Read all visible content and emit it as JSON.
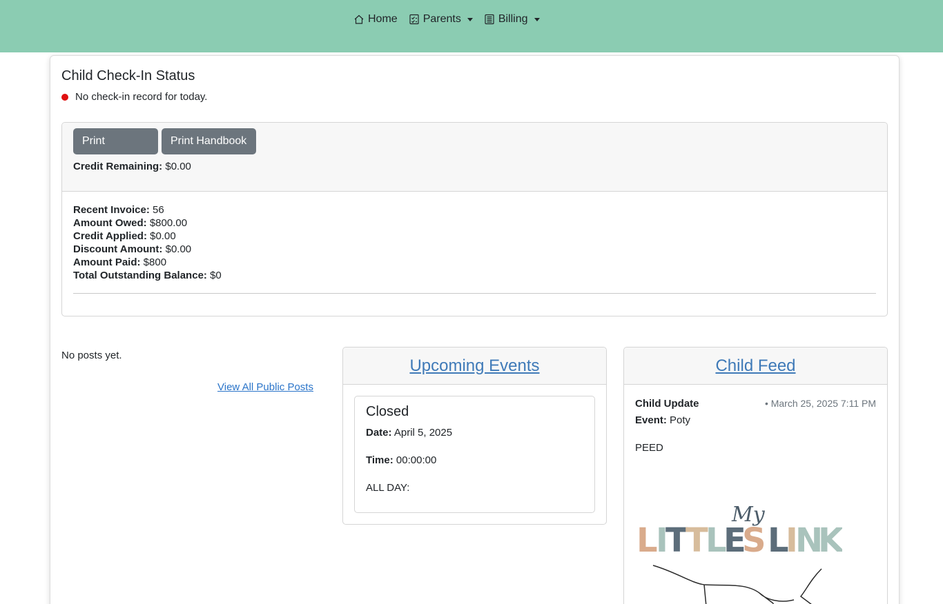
{
  "nav": {
    "home_label": "Home",
    "parents_label": "Parents",
    "billing_label": "Billing"
  },
  "checkin": {
    "title": "Child Check-In Status",
    "status_text": "No check-in record for today.",
    "status_color": "#e01010"
  },
  "billing": {
    "print_contract_label": "Print Contract",
    "print_handbook_label": "Print Handbook",
    "credit_remaining_label": "Credit Remaining:",
    "credit_remaining_value": "$0.00",
    "rows": [
      {
        "label": "Recent Invoice:",
        "value": "56"
      },
      {
        "label": "Amount Owed:",
        "value": "$800.00"
      },
      {
        "label": "Credit Applied:",
        "value": "$0.00"
      },
      {
        "label": "Discount Amount:",
        "value": "$0.00"
      },
      {
        "label": "Amount Paid:",
        "value": "$800"
      },
      {
        "label": "Total Outstanding Balance:",
        "value": "$0"
      }
    ]
  },
  "posts": {
    "empty_text": "No posts yet.",
    "view_all_label": "View All Public Posts"
  },
  "events": {
    "header": "Upcoming Events",
    "items": [
      {
        "title": "Closed",
        "date_label": "Date:",
        "date_value": "April 5, 2025",
        "time_label": "Time:",
        "time_value": "00:00:00",
        "all_day_label": "ALL DAY:"
      }
    ]
  },
  "feed": {
    "header": "Child Feed",
    "items": [
      {
        "title": "Child Update",
        "timestamp": "• March 25, 2025 7:11 PM",
        "event_label": "Event:",
        "event_value": "Poty",
        "text": "PEED",
        "logo_small": "My",
        "logo_text": "LITTLES LINK"
      }
    ]
  },
  "colors": {
    "navbar": "#8bccb2",
    "button": "#6c757d",
    "link": "#3f7ab8"
  }
}
